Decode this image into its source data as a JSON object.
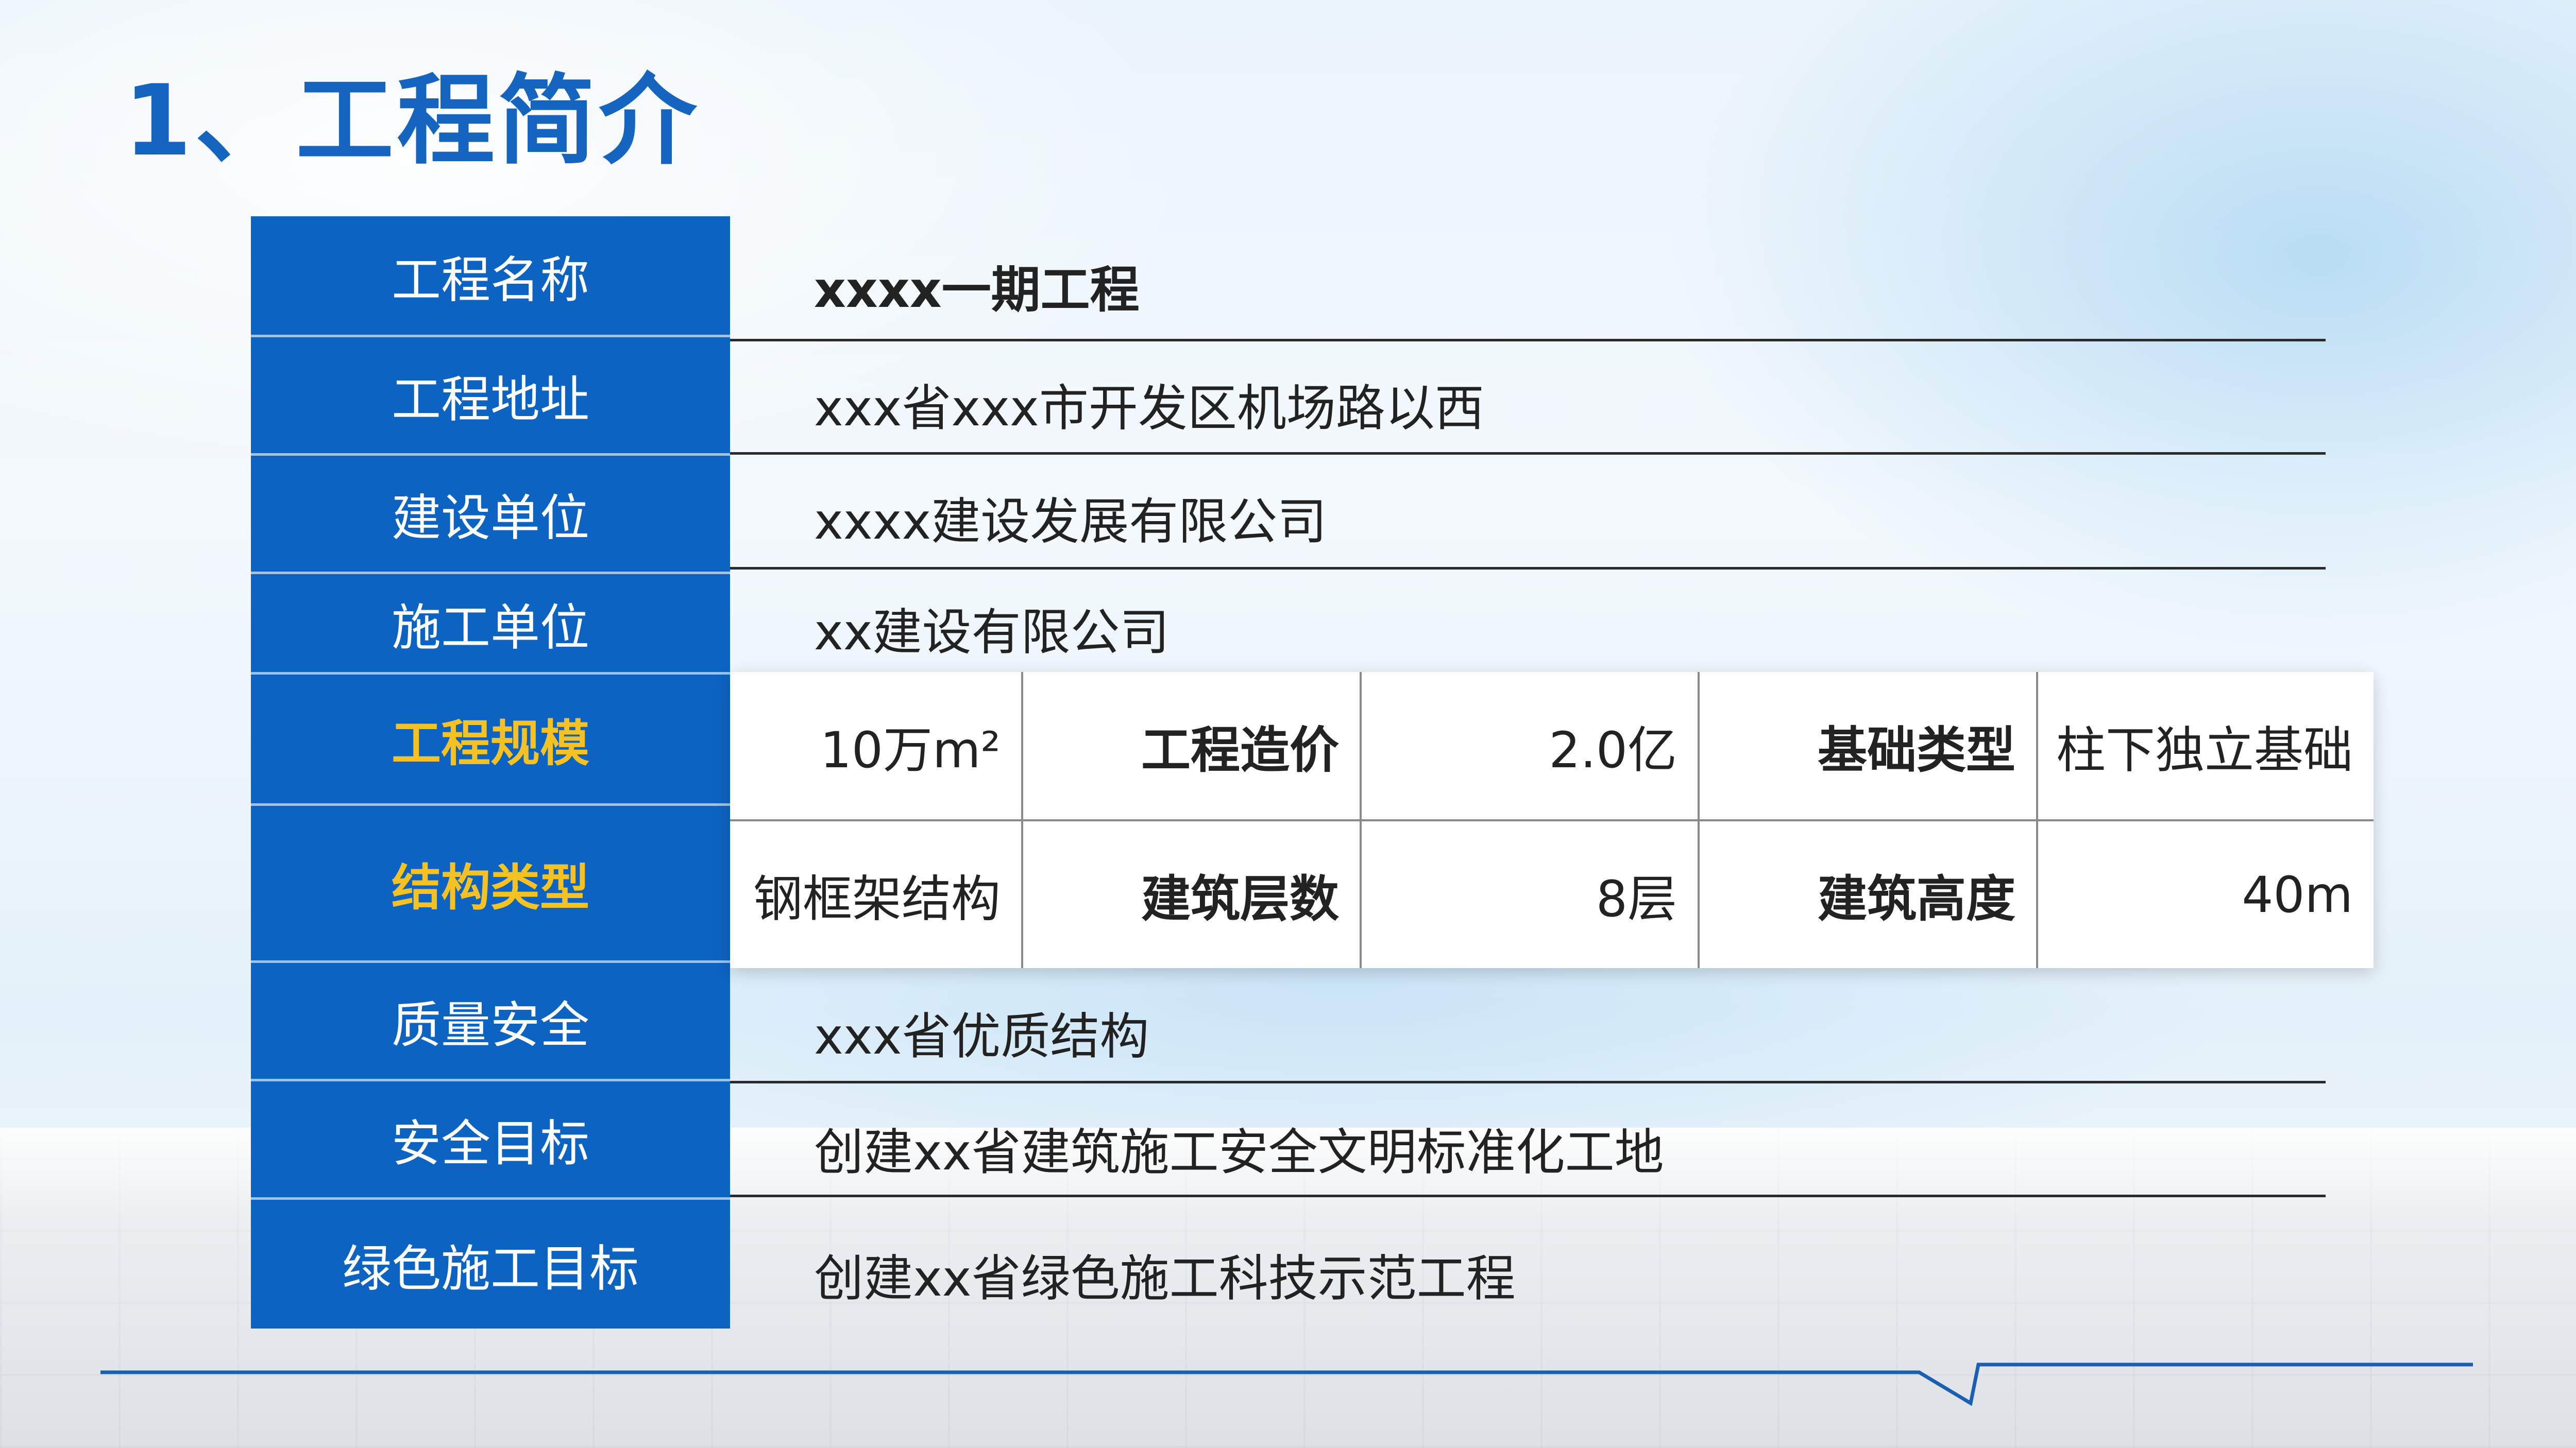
{
  "title": "1、工程简介",
  "rows": {
    "name": {
      "label": "工程名称",
      "value": "xxxx一期工程"
    },
    "address": {
      "label": "工程地址",
      "value": "xxx省xxx市开发区机场路以西"
    },
    "builder": {
      "label": "建设单位",
      "value": "xxxx建设发展有限公司"
    },
    "contractor": {
      "label": "施工单位",
      "value": "xx建设有限公司"
    },
    "scale": {
      "label": "工程规模"
    },
    "structure": {
      "label": "结构类型"
    },
    "quality": {
      "label": "质量安全",
      "value": "xxx省优质结构"
    },
    "safety": {
      "label": "安全目标",
      "value": "创建xx省建筑施工安全文明标准化工地"
    },
    "green": {
      "label": "绿色施工目标",
      "value": "创建xx省绿色施工科技示范工程"
    }
  },
  "grid": {
    "row1": {
      "area": "10万m²",
      "cost_label": "工程造价",
      "cost": "2.0亿",
      "foundation_label": "基础类型",
      "foundation": "柱下独立基础"
    },
    "row2": {
      "structure": "钢框架结构",
      "floors_label": "建筑层数",
      "floors": "8层",
      "height_label": "建筑高度",
      "height": "40m"
    }
  },
  "colors": {
    "accent": "#0d63c2",
    "title": "#1565c0",
    "highlight": "#f6c223"
  }
}
